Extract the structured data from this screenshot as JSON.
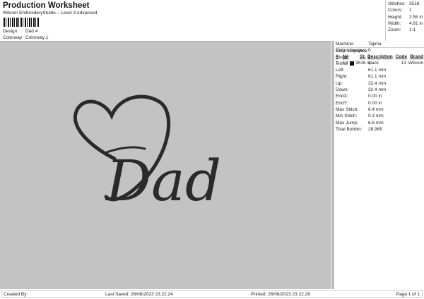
{
  "header": {
    "title": "Production Worksheet",
    "subtitle": "Wilcom EmbroideryStudio – Level 3 Advanced",
    "design_label": "Design:",
    "design": "Dad 4",
    "colorway_label": "Colorway:",
    "colorway": "Colorway 1"
  },
  "summary": [
    {
      "k": "Stitches:",
      "v": "3518"
    },
    {
      "k": "Colors:",
      "v": "1"
    },
    {
      "k": "Height:",
      "v": "2.55 in"
    },
    {
      "k": "Width:",
      "v": "4.81 in"
    },
    {
      "k": "Zoom:",
      "v": "1:1"
    }
  ],
  "info": [
    {
      "k": "Machine:",
      "v": "Tajima"
    },
    {
      "k": "Color changes:",
      "v": "0"
    },
    {
      "k": "Stops:",
      "v": "1"
    },
    {
      "k": "Trims:",
      "v": "4"
    },
    {
      "k": "Left:",
      "v": "61.1 mm"
    },
    {
      "k": "Right:",
      "v": "61.1 mm"
    },
    {
      "k": "Up:",
      "v": "32.4 mm"
    },
    {
      "k": "Down:",
      "v": "32.4 mm"
    },
    {
      "k": "EndX:",
      "v": "0.00 in"
    },
    {
      "k": "EndY:",
      "v": "0.00 in"
    },
    {
      "k": "Max Stitch:",
      "v": "6.4 mm"
    },
    {
      "k": "Min Stitch:",
      "v": "0.3 mm"
    },
    {
      "k": "Max Jump:",
      "v": "6.8 mm"
    },
    {
      "k": "Total Bobbin:",
      "v": "28.96ft"
    }
  ],
  "stop_sequence": {
    "label": "Stop Sequence:",
    "headers": [
      "#",
      "N#",
      "St.",
      "Description",
      "Code",
      "Brand"
    ],
    "rows": [
      {
        "num": "1.",
        "n": "13",
        "color": "#111111",
        "st": "3516",
        "desc": "Black",
        "code": "13",
        "brand": "Wilcom"
      }
    ]
  },
  "design_text": "Dad",
  "thread_color": "#2a2a2a",
  "footer": {
    "created": "Created By:",
    "saved": "Last Saved: 26/06/2023 23.22.24",
    "printed": "Printed: 26/06/2023 23.22.26",
    "page": "Page 1 of 1"
  }
}
